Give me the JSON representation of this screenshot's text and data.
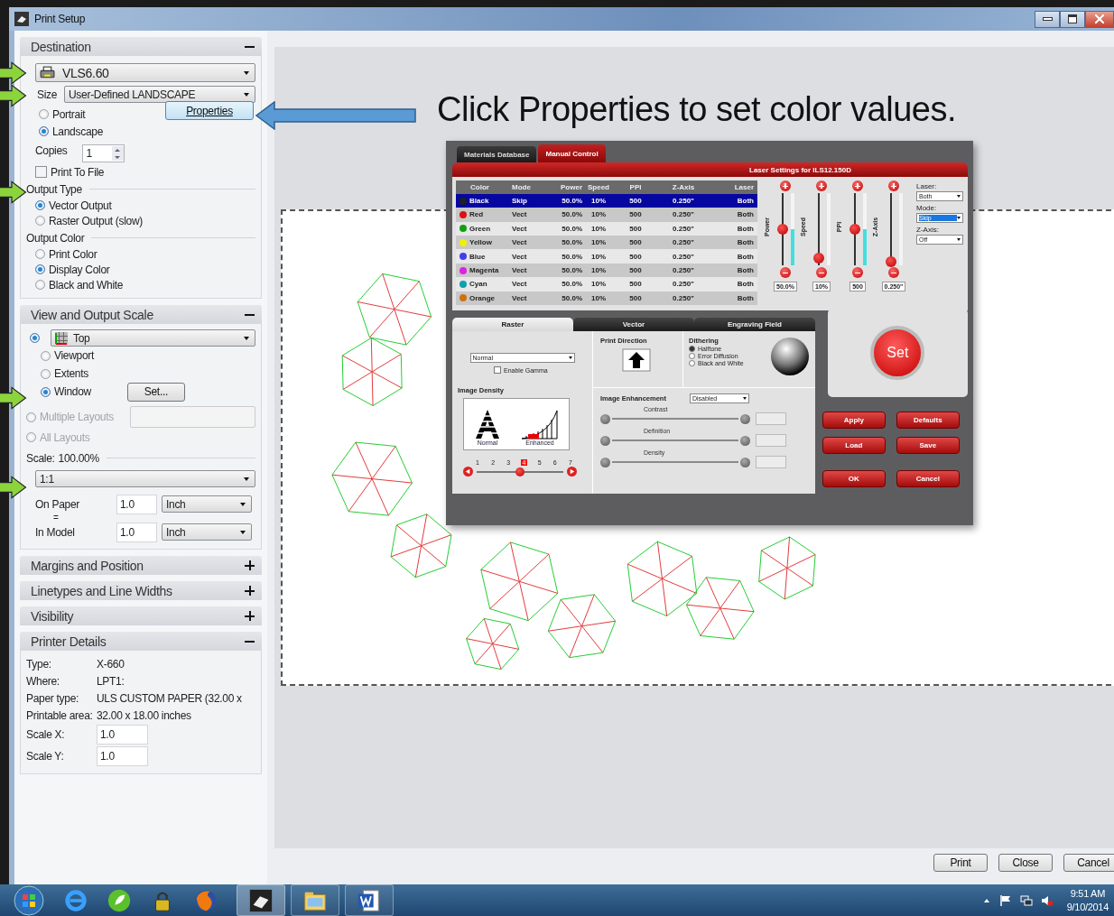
{
  "window": {
    "title": "Print Setup"
  },
  "destination": {
    "title": "Destination",
    "expanded": true,
    "printer": "VLS6.60",
    "size_label": "Size",
    "size": "User-Defined LANDSCAPE",
    "orientations": [
      {
        "label": "Portrait",
        "selected": false
      },
      {
        "label": "Landscape",
        "selected": true
      }
    ],
    "properties_button": "Properties",
    "copies_label": "Copies",
    "copies": "1",
    "print_to_file": {
      "label": "Print To File",
      "checked": false
    },
    "output_type": {
      "title": "Output Type",
      "options": [
        {
          "label": "Vector Output",
          "selected": true
        },
        {
          "label": "Raster Output (slow)",
          "selected": false
        }
      ]
    },
    "output_color": {
      "title": "Output Color",
      "options": [
        {
          "label": "Print Color",
          "selected": false
        },
        {
          "label": "Display Color",
          "selected": true
        },
        {
          "label": "Black and White",
          "selected": false
        }
      ]
    }
  },
  "view_scale": {
    "title": "View and Output Scale",
    "expanded": true,
    "view_selected": true,
    "view": "Top",
    "options": [
      {
        "label": "Viewport",
        "selected": false
      },
      {
        "label": "Extents",
        "selected": false
      },
      {
        "label": "Window",
        "selected": true
      }
    ],
    "set_button": "Set...",
    "multiple_layouts": {
      "label": "Multiple Layouts",
      "disabled": true,
      "selected": false
    },
    "all_layouts": {
      "label": "All Layouts",
      "disabled": true,
      "selected": false
    },
    "scale_label": "Scale:",
    "scale_value": "100.00%",
    "scale": "1:1",
    "on_paper": {
      "label": "On Paper",
      "value": "1.0",
      "unit": "Inch"
    },
    "equals": "=",
    "in_model": {
      "label": "In Model",
      "value": "1.0",
      "unit": "Inch"
    }
  },
  "collapsed_sections": [
    {
      "title": "Margins and Position",
      "expanded": false
    },
    {
      "title": "Linetypes and Line Widths",
      "expanded": false
    },
    {
      "title": "Visibility",
      "expanded": false
    }
  ],
  "printer_details": {
    "title": "Printer Details",
    "expanded": true,
    "rows": [
      {
        "label": "Type:",
        "value": "X-660"
      },
      {
        "label": "Where:",
        "value": "LPT1:"
      },
      {
        "label": "Paper type:",
        "value": "ULS CUSTOM PAPER  (32.00 x"
      },
      {
        "label": "Printable area:",
        "value": "32.00 x 18.00 inches"
      }
    ],
    "scale_x": {
      "label": "Scale X:",
      "value": "1.0"
    },
    "scale_y": {
      "label": "Scale Y:",
      "value": "1.0"
    }
  },
  "callout": "Click Properties to set color values.",
  "dialog": {
    "tabs": [
      {
        "label": "Materials Database",
        "selected": false
      },
      {
        "label": "Manual Control",
        "selected": true
      }
    ],
    "header": "Laser Settings for ILS12.150D",
    "columns": [
      "Color",
      "Mode",
      "Power",
      "Speed",
      "PPI",
      "Z-Axis",
      "Laser"
    ],
    "rows": [
      {
        "color": "#202020",
        "name": "Black",
        "mode": "Skip",
        "power": "50.0%",
        "speed": "10%",
        "ppi": "500",
        "z_axis": "0.250\"",
        "laser": "Both",
        "selected": true
      },
      {
        "color": "#e01010",
        "name": "Red",
        "mode": "Vect",
        "power": "50.0%",
        "speed": "10%",
        "ppi": "500",
        "z_axis": "0.250\"",
        "laser": "Both",
        "selected": false
      },
      {
        "color": "#10a010",
        "name": "Green",
        "mode": "Vect",
        "power": "50.0%",
        "speed": "10%",
        "ppi": "500",
        "z_axis": "0.250\"",
        "laser": "Both",
        "selected": false
      },
      {
        "color": "#f0f000",
        "name": "Yellow",
        "mode": "Vect",
        "power": "50.0%",
        "speed": "10%",
        "ppi": "500",
        "z_axis": "0.250\"",
        "laser": "Both",
        "selected": false
      },
      {
        "color": "#4040f0",
        "name": "Blue",
        "mode": "Vect",
        "power": "50.0%",
        "speed": "10%",
        "ppi": "500",
        "z_axis": "0.250\"",
        "laser": "Both",
        "selected": false
      },
      {
        "color": "#e020e0",
        "name": "Magenta",
        "mode": "Vect",
        "power": "50.0%",
        "speed": "10%",
        "ppi": "500",
        "z_axis": "0.250\"",
        "laser": "Both",
        "selected": false
      },
      {
        "color": "#10a0b0",
        "name": "Cyan",
        "mode": "Vect",
        "power": "50.0%",
        "speed": "10%",
        "ppi": "500",
        "z_axis": "0.250\"",
        "laser": "Both",
        "selected": false
      },
      {
        "color": "#d07010",
        "name": "Orange",
        "mode": "Vect",
        "power": "50.0%",
        "speed": "10%",
        "ppi": "500",
        "z_axis": "0.250\"",
        "laser": "Both",
        "selected": false
      }
    ],
    "sliders": [
      {
        "label": "Power",
        "level": 0.5,
        "indicator": true,
        "reading": "50.0%"
      },
      {
        "label": "Speed",
        "level": 0.1,
        "indicator": false,
        "reading": "10%"
      },
      {
        "label": "PPI",
        "level": 0.5,
        "indicator": true,
        "reading": "500"
      },
      {
        "label": "Z-Axis",
        "level": 0.05,
        "indicator": false,
        "reading": "0.250\""
      }
    ],
    "fields": [
      {
        "label": "Laser:",
        "value": "Both",
        "selected": false
      },
      {
        "label": "Mode:",
        "value": "Skip",
        "selected": true
      },
      {
        "label": "Z-Axis:",
        "value": "Off",
        "selected": false
      }
    ],
    "lower_tabs": [
      {
        "label": "Raster",
        "selected": true
      },
      {
        "label": "Vector",
        "selected": false
      },
      {
        "label": "Engraving Field",
        "selected": false
      }
    ],
    "raster_mode": "Normal",
    "gamma": {
      "label": "Enable Gamma",
      "checked": false
    },
    "density_title": "Image Density",
    "density_captions": [
      "Normal",
      "Enhanced"
    ],
    "density_steps": [
      {
        "label": "1",
        "selected": false
      },
      {
        "label": "2",
        "selected": false
      },
      {
        "label": "3",
        "selected": false
      },
      {
        "label": "4",
        "selected": true
      },
      {
        "label": "5",
        "selected": false
      },
      {
        "label": "6",
        "selected": false
      },
      {
        "label": "7",
        "selected": false
      }
    ],
    "density_level": {
      "level": 0.5
    },
    "print_direction": "Print Direction",
    "dithering": {
      "title": "Dithering",
      "options": [
        {
          "label": "Halftone",
          "selected": true
        },
        {
          "label": "Error Diffusion",
          "selected": false
        },
        {
          "label": "Black and White",
          "selected": false
        }
      ]
    },
    "enhancement": {
      "label": "Image Enhancement",
      "value": "Disabled",
      "disabled": true,
      "sliders": [
        "Contrast",
        "Definition",
        "Density"
      ]
    },
    "set_button": "Set",
    "buttons": [
      "Apply",
      "Defaults",
      "Load",
      "Save",
      "OK",
      "Cancel"
    ]
  },
  "buttons": [
    "Print",
    "Close",
    "Cancel"
  ],
  "taskbar": {
    "time": "9:51 AM",
    "date": "9/10/2014"
  }
}
